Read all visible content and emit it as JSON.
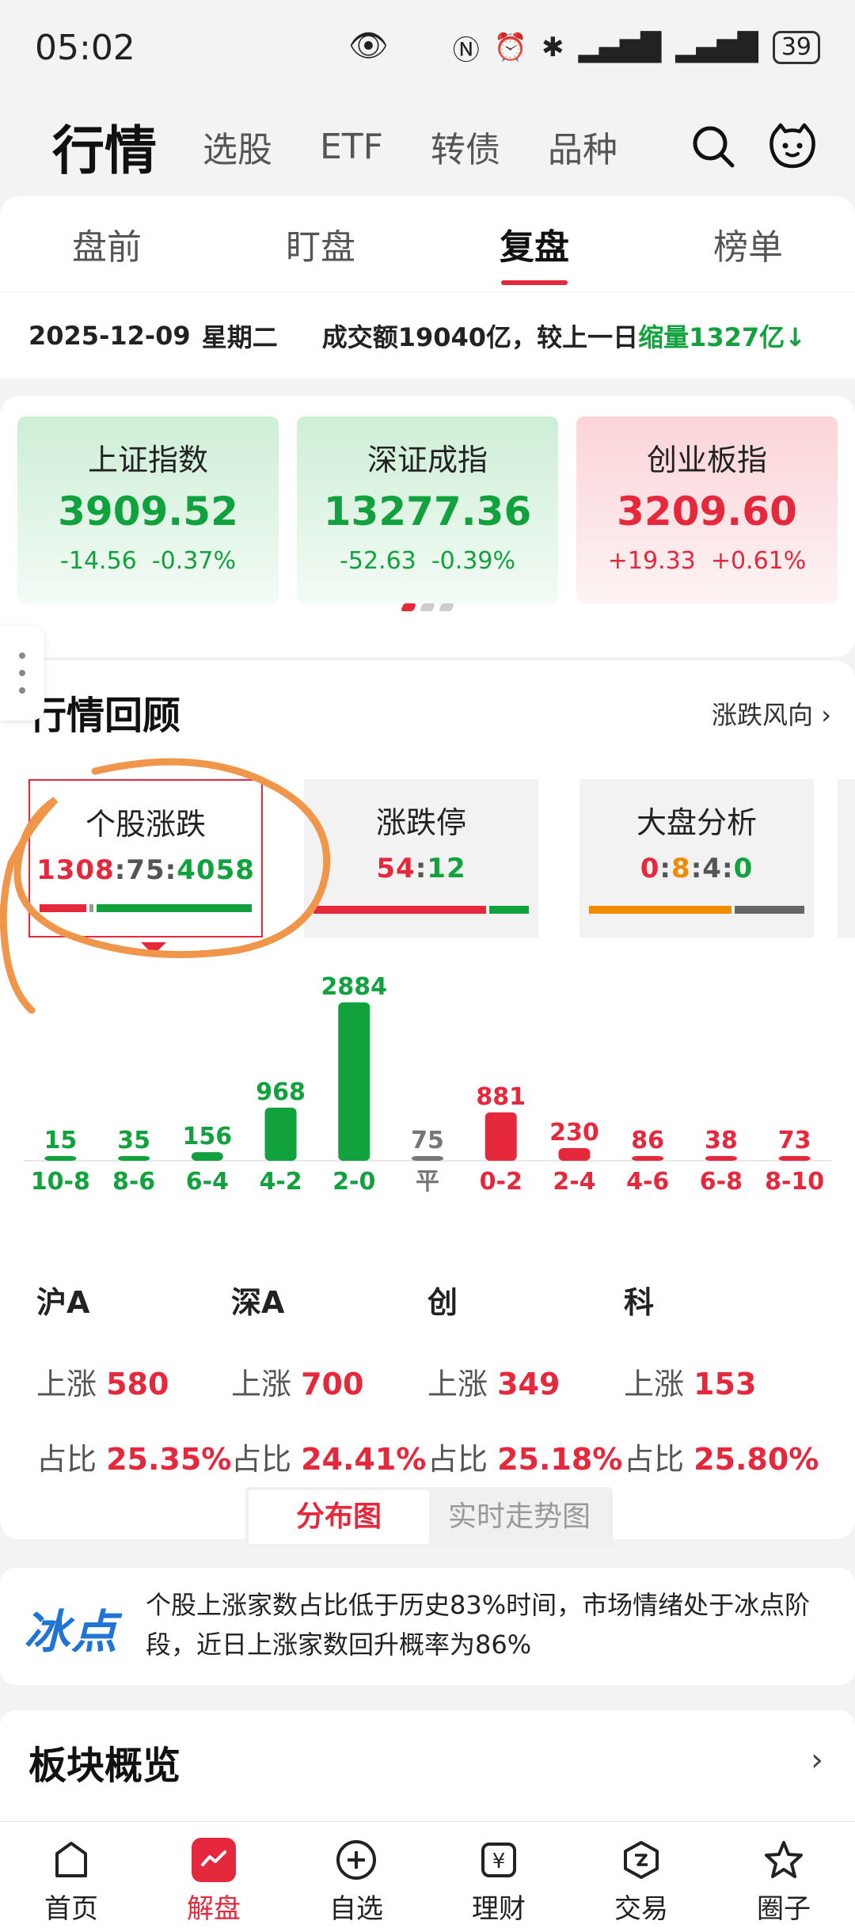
{
  "status": {
    "time": "05:02",
    "battery": "39"
  },
  "nav": {
    "title": "行情",
    "links": [
      "选股",
      "ETF",
      "转债",
      "品种"
    ]
  },
  "subtabs": [
    "盘前",
    "盯盘",
    "复盘",
    "榜单"
  ],
  "summary": {
    "date": "2025-12-09",
    "weekday": "星期二",
    "turnover_prefix": "成交额",
    "turnover": "19040亿",
    "compare": "，较上一日",
    "change": "缩量1327亿↓"
  },
  "indices": [
    {
      "name": "上证指数",
      "value": "3909.52",
      "change": "-14.56",
      "percent": "-0.37%",
      "dir": "down"
    },
    {
      "name": "深证成指",
      "value": "13277.36",
      "change": "-52.63",
      "percent": "-0.39%",
      "dir": "down"
    },
    {
      "name": "创业板指",
      "value": "3209.60",
      "change": "+19.33",
      "percent": "+0.61%",
      "dir": "up"
    }
  ],
  "review": {
    "title": "行情回顾",
    "trend_link": "涨跌风向 ›",
    "cards": [
      {
        "name": "个股涨跌",
        "values": [
          "1308",
          "75",
          "4058"
        ],
        "sep": ":"
      },
      {
        "name": "涨跌停",
        "values": [
          "54",
          "12"
        ],
        "sep": ":"
      },
      {
        "name": "大盘分析",
        "values": [
          "0",
          "8",
          "4",
          "0"
        ],
        "sep": ":"
      }
    ]
  },
  "chart_data": {
    "type": "bar",
    "categories": [
      "10-8",
      "8-6",
      "6-4",
      "4-2",
      "2-0",
      "平",
      "0-2",
      "2-4",
      "4-6",
      "6-8",
      "8-10"
    ],
    "values": [
      15,
      35,
      156,
      968,
      2884,
      75,
      881,
      230,
      86,
      38,
      73
    ],
    "colors": [
      "#12a23d",
      "#12a23d",
      "#12a23d",
      "#12a23d",
      "#12a23d",
      "#777777",
      "#e6283c",
      "#e6283c",
      "#e6283c",
      "#e6283c",
      "#e6283c"
    ]
  },
  "markets": [
    {
      "name": "沪A",
      "up_label": "上涨",
      "up": "580",
      "ratio_label": "占比",
      "ratio": "25.35%"
    },
    {
      "name": "深A",
      "up_label": "上涨",
      "up": "700",
      "ratio_label": "占比",
      "ratio": "24.41%"
    },
    {
      "name": "创",
      "up_label": "上涨",
      "up": "349",
      "ratio_label": "占比",
      "ratio": "25.18%"
    },
    {
      "name": "科",
      "up_label": "上涨",
      "up": "153",
      "ratio_label": "占比",
      "ratio": "25.80%"
    }
  ],
  "toggle": {
    "left": "分布图",
    "right": "实时走势图"
  },
  "freeze": {
    "badge": "冰点",
    "text": "个股上涨家数占比低于历史83%时间，市场情绪处于冰点阶段，近日上涨家数回升概率为86%"
  },
  "sector": {
    "title": "板块概览"
  },
  "bottom_nav": [
    "首页",
    "解盘",
    "自选",
    "理财",
    "交易",
    "圈子"
  ],
  "colors": {
    "red": "#e6283c",
    "green": "#12a23d",
    "orange": "#f08c00",
    "blue": "#1f74d6"
  }
}
